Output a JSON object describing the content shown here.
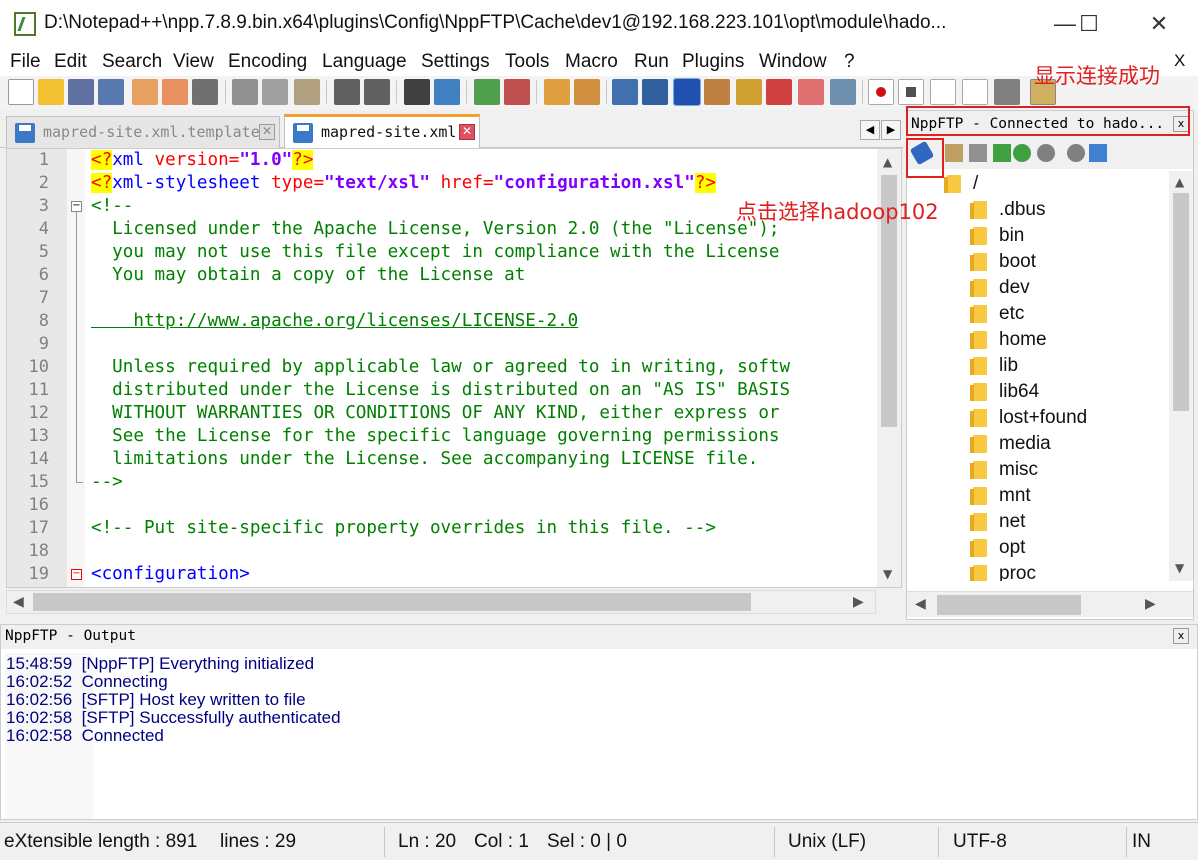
{
  "window": {
    "title": "D:\\Notepad++\\npp.7.8.9.bin.x64\\plugins\\Config\\NppFTP\\Cache\\dev1@192.168.223.101\\opt\\module\\hado...",
    "minimize": "—",
    "maximize": "☐",
    "close": "✕"
  },
  "menu": [
    "File",
    "Edit",
    "Search",
    "View",
    "Encoding",
    "Language",
    "Settings",
    "Tools",
    "Macro",
    "Run",
    "Plugins",
    "Window",
    "?"
  ],
  "menu_close": "X",
  "tabs": [
    {
      "label": "mapred-site.xml.template",
      "active": false
    },
    {
      "label": "mapred-site.xml",
      "active": true
    }
  ],
  "editor": {
    "line_numbers": [
      "1",
      "2",
      "3",
      "4",
      "5",
      "6",
      "7",
      "8",
      "9",
      "10",
      "11",
      "12",
      "13",
      "14",
      "15",
      "16",
      "17",
      "18",
      "19"
    ],
    "lines": [
      {
        "pi_open": "<?",
        "tag": "xml",
        "attr": " version=",
        "str": "\"1.0\"",
        "pi_close": "?>"
      },
      {
        "pi_open": "<?",
        "tag": "xml-stylesheet",
        "a1": " type=",
        "s1": "\"text/xsl\"",
        "a2": " href=",
        "s2": "\"configuration.xsl\"",
        "pi_close": "?>"
      },
      "<!--",
      "  Licensed under the Apache License, Version 2.0 (the \"License\");",
      "  you may not use this file except in compliance with the License",
      "  You may obtain a copy of the License at",
      "",
      "    http://www.apache.org/licenses/LICENSE-2.0",
      "",
      "  Unless required by applicable law or agreed to in writing, softw",
      "  distributed under the License is distributed on an \"AS IS\" BASIS",
      "  WITHOUT WARRANTIES OR CONDITIONS OF ANY KIND, either express or",
      "  See the License for the specific language governing permissions",
      "  limitations under the License. See accompanying LICENSE file.",
      "-->",
      "",
      "<!-- Put site-specific property overrides in this file. -->",
      "",
      "<configuration>"
    ]
  },
  "ftp": {
    "title": "NppFTP - Connected to hado...",
    "close": "x",
    "tree": [
      "/",
      ".dbus",
      "bin",
      "boot",
      "dev",
      "etc",
      "home",
      "lib",
      "lib64",
      "lost+found",
      "media",
      "misc",
      "mnt",
      "net",
      "opt",
      "proc"
    ]
  },
  "output": {
    "title": "NppFTP - Output",
    "close": "x",
    "lines": [
      {
        "time": "15:48:59",
        "msg": "[NppFTP] Everything initialized"
      },
      {
        "time": "16:02:52",
        "msg": "Connecting"
      },
      {
        "time": "16:02:56",
        "msg": "[SFTP] Host key written to file"
      },
      {
        "time": "16:02:58",
        "msg": "[SFTP] Successfully authenticated"
      },
      {
        "time": "16:02:58",
        "msg": "Connected"
      }
    ]
  },
  "status": {
    "type": "eXtensible",
    "length": "length : 891",
    "lines": "lines : 29",
    "ln": "Ln : 20",
    "col": "Col : 1",
    "sel": "Sel : 0 | 0",
    "eol": "Unix (LF)",
    "encoding": "UTF-8",
    "mode": "IN"
  },
  "annotations": {
    "connected": "显示连接成功",
    "select": "点击选择hadoop102"
  },
  "colors": {
    "annotation": "#e02020",
    "comment": "#008000",
    "string": "#8000ff",
    "tag": "#0000ff",
    "attr": "#ff0000",
    "log": "#000080"
  }
}
